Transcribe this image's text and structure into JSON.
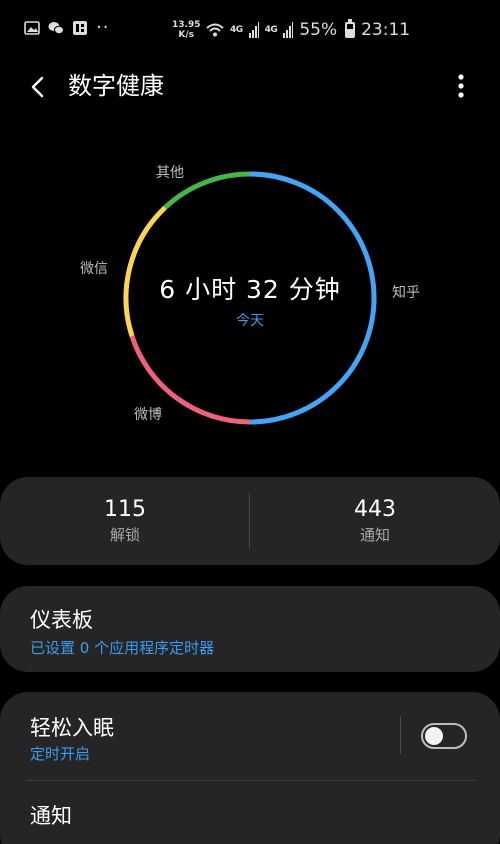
{
  "status_bar": {
    "net_speed_value": "13.95",
    "net_speed_unit": "K/s",
    "signal1": "4G",
    "signal2": "4G",
    "battery": "55%",
    "time": "23:11"
  },
  "header": {
    "title": "数字健康"
  },
  "chart_data": {
    "type": "pie",
    "center_value": "6 小时 32 分钟",
    "center_label": "今天",
    "slices": [
      {
        "name": "知乎",
        "share": 0.5,
        "color": "#42a5f5"
      },
      {
        "name": "微博",
        "share": 0.2,
        "color": "#f0607a"
      },
      {
        "name": "微信",
        "share": 0.18,
        "color": "#ffd54f"
      },
      {
        "name": "其他",
        "share": 0.12,
        "color": "#43b649"
      }
    ]
  },
  "stats": {
    "unlocks": {
      "value": "115",
      "label": "解锁"
    },
    "notifications": {
      "value": "443",
      "label": "通知"
    }
  },
  "dashboard": {
    "title": "仪表板",
    "subtitle": "已设置 0 个应用程序定时器"
  },
  "wind_down": {
    "title": "轻松入眠",
    "subtitle": "定时开启",
    "enabled": false
  },
  "notifications_item": {
    "title": "通知"
  }
}
